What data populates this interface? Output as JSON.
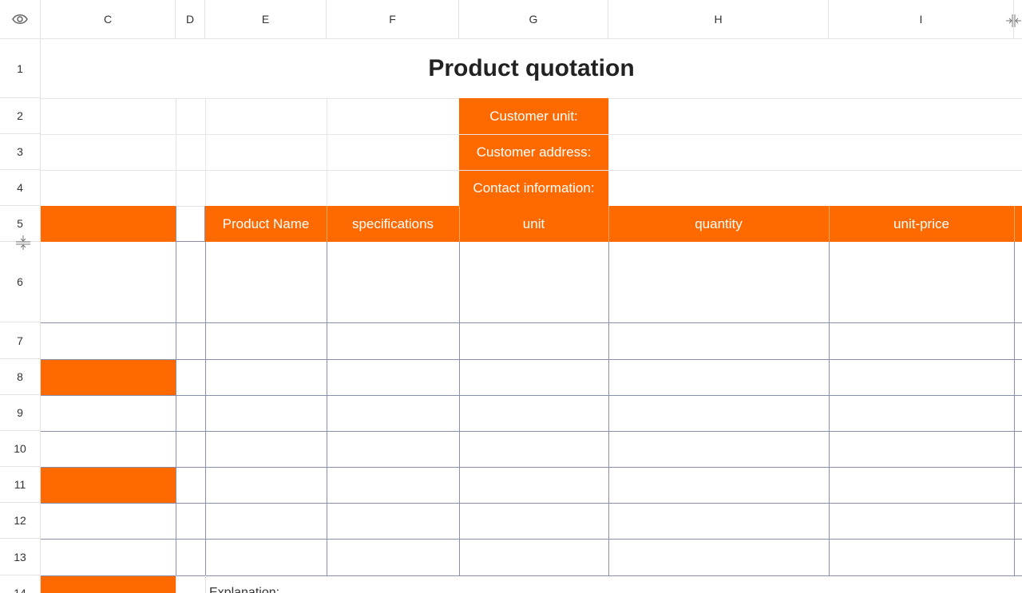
{
  "columns": [
    "C",
    "D",
    "E",
    "F",
    "G",
    "H",
    "I"
  ],
  "rows": [
    "1",
    "2",
    "3",
    "4",
    "5",
    "6",
    "7",
    "8",
    "9",
    "10",
    "11",
    "12",
    "13",
    "14"
  ],
  "title": "Product quotation",
  "customer_labels": [
    "Customer unit:",
    "Customer address:",
    "Contact information:"
  ],
  "table_headers": [
    "Product Name",
    "specifications",
    "unit",
    "quantity",
    "unit-price"
  ],
  "explanation": "Explanation:",
  "colors": {
    "accent": "#ff6a00",
    "table_border": "#8a8fae",
    "grid": "#e6e6e6"
  },
  "icons": {
    "corner": "eye-icon",
    "col_freeze": "freeze-column-icon",
    "row_freeze": "freeze-row-icon"
  }
}
